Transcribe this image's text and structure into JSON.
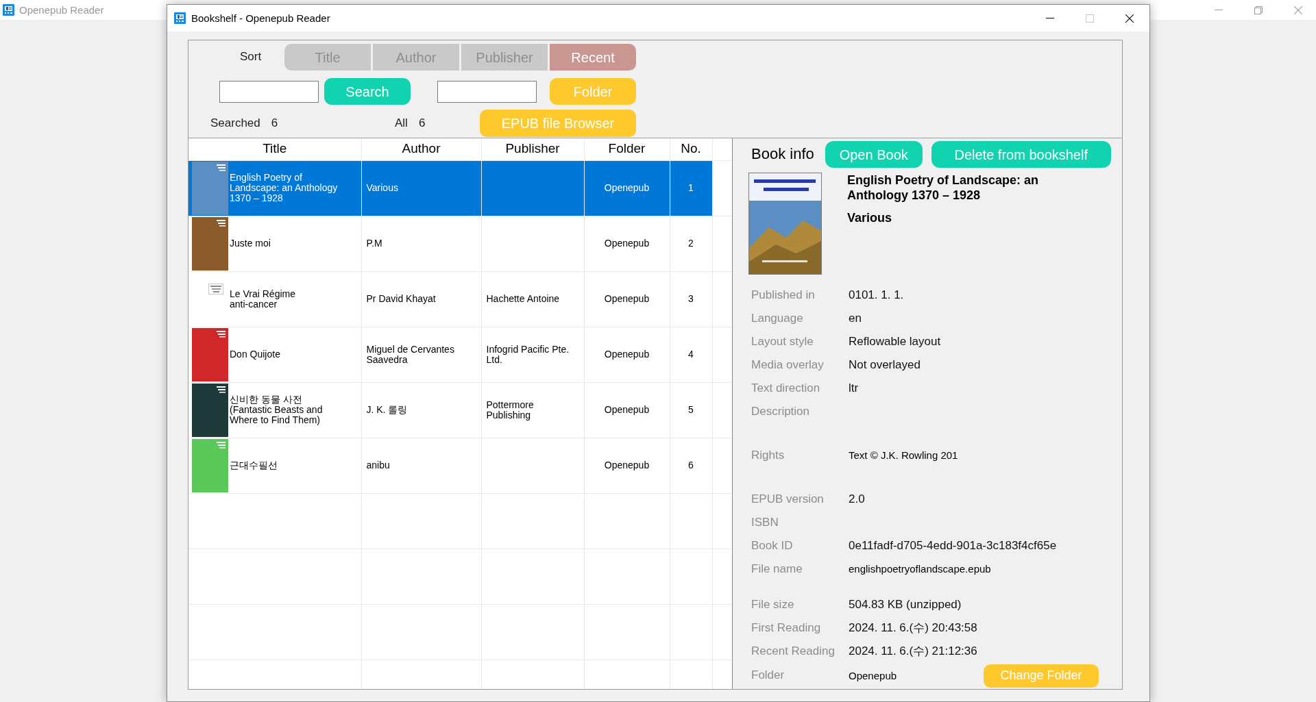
{
  "app_window": {
    "title": "Openepub Reader",
    "active": false,
    "controls": [
      {
        "kind": "minimize"
      },
      {
        "kind": "restore"
      },
      {
        "kind": "close"
      }
    ]
  },
  "window": {
    "title": "Bookshelf - Openepub Reader",
    "active": true,
    "controls": [
      {
        "kind": "minimize",
        "disabled": false
      },
      {
        "kind": "maximize",
        "disabled": true
      },
      {
        "kind": "close",
        "disabled": false
      }
    ]
  },
  "sort": {
    "label": "Sort",
    "options": [
      {
        "label": "Title",
        "selected": false
      },
      {
        "label": "Author",
        "selected": false
      },
      {
        "label": "Publisher",
        "selected": false
      },
      {
        "label": "Recent",
        "selected": true
      }
    ]
  },
  "search": {
    "button": "Search"
  },
  "folder_filter": {
    "button": "Folder"
  },
  "counts": [
    {
      "label": "Searched",
      "value": "6"
    },
    {
      "label": "All",
      "value": "6"
    }
  ],
  "browser_button": "EPUB file Browser",
  "table": {
    "columns": [
      "Title",
      "Author",
      "Publisher",
      "Folder",
      "No."
    ],
    "rows": [
      {
        "title": "English Poetry of Landscape: an Anthology 1370 – 1928",
        "author": "Various",
        "folder": "Openepub",
        "no": "1",
        "selected": true,
        "color": "#5b8fc4"
      },
      {
        "title": "Juste moi",
        "author": "P.M",
        "folder": "Openepub",
        "no": "2",
        "selected": false,
        "color": "#8a5a2a"
      },
      {
        "title": "Le Vrai Régime anti-cancer",
        "author": "Pr David Khayat",
        "publisher": "Hachette Antoine",
        "folder": "Openepub",
        "no": "3",
        "selected": false
      },
      {
        "title": "Don Quijote",
        "author": "Miguel de Cervantes Saavedra",
        "publisher": "Infogrid Pacific Pte. Ltd.",
        "folder": "Openepub",
        "no": "4",
        "selected": false,
        "color": "#d0282a"
      },
      {
        "title": "신비한 동물 사전 (Fantastic Beasts and Where to Find Them)",
        "author": "J. K. 롤링",
        "publisher": "Pottermore Publishing",
        "folder": "Openepub",
        "no": "5",
        "selected": false,
        "color": "#1e3a3a"
      },
      {
        "title": "근대수필선",
        "author": "anibu",
        "folder": "Openepub",
        "no": "6",
        "selected": false,
        "color": "#5cc85a"
      }
    ]
  },
  "book_info": {
    "heading": "Book info",
    "buttons": [
      "Open Book",
      "Delete from bookshelf"
    ],
    "title": "English Poetry of Landscape: an Anthology 1370 – 1928",
    "author": "Various",
    "fields": [
      {
        "label": "Published in",
        "value": "0101. 1. 1.",
        "kind": "line"
      },
      {
        "label": "Language",
        "value": "en",
        "kind": "line"
      },
      {
        "label": "Layout style",
        "value": "Reflowable layout",
        "kind": "line"
      },
      {
        "label": "Media overlay",
        "value": "Not overlayed",
        "kind": "line"
      },
      {
        "label": "Text direction",
        "value": "ltr",
        "kind": "line"
      },
      {
        "label": "Description",
        "kind": "area"
      },
      {
        "label": "Rights",
        "value": "Text © J.K. Rowling 201",
        "kind": "area"
      },
      {
        "label": "EPUB version",
        "value": "2.0",
        "kind": "line"
      },
      {
        "label": "ISBN",
        "kind": "line"
      },
      {
        "label": "Book ID",
        "value": "0e11fadf-d705-4edd-901a-3c183f4cf65e",
        "kind": "line"
      },
      {
        "label": "File name",
        "value": "englishpoetryoflandscape.epub",
        "kind": "wrap"
      },
      {
        "label": "File size",
        "value": "504.83 KB (unzipped)",
        "kind": "line"
      },
      {
        "label": "First Reading",
        "value": "2024. 11. 6.(수) 20:43:58",
        "kind": "line"
      },
      {
        "label": "Recent Reading",
        "value": "2024. 11. 6.(수) 21:12:36",
        "kind": "line"
      }
    ],
    "folder": {
      "label": "Folder",
      "value": "Openepub",
      "button": "Change Folder"
    }
  }
}
